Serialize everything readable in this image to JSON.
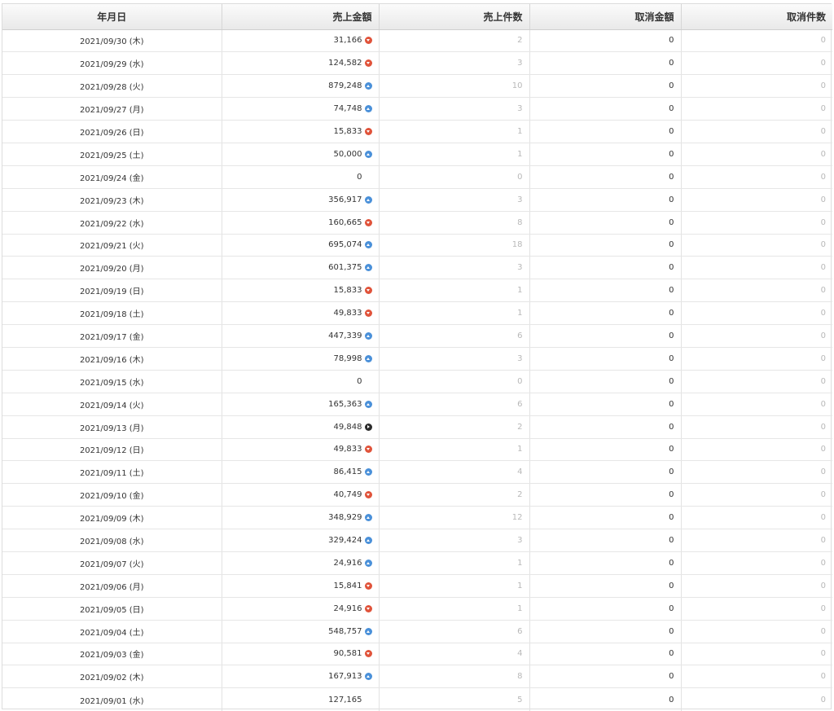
{
  "table": {
    "headers": {
      "date": "年月日",
      "sales_amount": "売上金額",
      "sales_count": "売上件数",
      "cancel_amount": "取消金額",
      "cancel_count": "取消件数"
    },
    "trend_icons": {
      "up": "arrow-up-circle-icon",
      "down": "arrow-down-circle-icon",
      "flat": "arrow-right-circle-icon"
    },
    "colors": {
      "up": "#4a90d9",
      "down": "#e0533a",
      "flat": "#2b2b2b"
    },
    "rows": [
      {
        "date": "2021/09/30 (木)",
        "sales_amount": "31,166",
        "trend": "down",
        "sales_count": "2",
        "cancel_amount": "0",
        "cancel_count": "0"
      },
      {
        "date": "2021/09/29 (水)",
        "sales_amount": "124,582",
        "trend": "down",
        "sales_count": "3",
        "cancel_amount": "0",
        "cancel_count": "0"
      },
      {
        "date": "2021/09/28 (火)",
        "sales_amount": "879,248",
        "trend": "up",
        "sales_count": "10",
        "cancel_amount": "0",
        "cancel_count": "0"
      },
      {
        "date": "2021/09/27 (月)",
        "sales_amount": "74,748",
        "trend": "up",
        "sales_count": "3",
        "cancel_amount": "0",
        "cancel_count": "0"
      },
      {
        "date": "2021/09/26 (日)",
        "sales_amount": "15,833",
        "trend": "down",
        "sales_count": "1",
        "cancel_amount": "0",
        "cancel_count": "0"
      },
      {
        "date": "2021/09/25 (土)",
        "sales_amount": "50,000",
        "trend": "up",
        "sales_count": "1",
        "cancel_amount": "0",
        "cancel_count": "0"
      },
      {
        "date": "2021/09/24 (金)",
        "sales_amount": "0",
        "trend": "none",
        "sales_count": "0",
        "cancel_amount": "0",
        "cancel_count": "0"
      },
      {
        "date": "2021/09/23 (木)",
        "sales_amount": "356,917",
        "trend": "up",
        "sales_count": "3",
        "cancel_amount": "0",
        "cancel_count": "0"
      },
      {
        "date": "2021/09/22 (水)",
        "sales_amount": "160,665",
        "trend": "down",
        "sales_count": "8",
        "cancel_amount": "0",
        "cancel_count": "0"
      },
      {
        "date": "2021/09/21 (火)",
        "sales_amount": "695,074",
        "trend": "up",
        "sales_count": "18",
        "cancel_amount": "0",
        "cancel_count": "0"
      },
      {
        "date": "2021/09/20 (月)",
        "sales_amount": "601,375",
        "trend": "up",
        "sales_count": "3",
        "cancel_amount": "0",
        "cancel_count": "0"
      },
      {
        "date": "2021/09/19 (日)",
        "sales_amount": "15,833",
        "trend": "down",
        "sales_count": "1",
        "cancel_amount": "0",
        "cancel_count": "0"
      },
      {
        "date": "2021/09/18 (土)",
        "sales_amount": "49,833",
        "trend": "down",
        "sales_count": "1",
        "cancel_amount": "0",
        "cancel_count": "0"
      },
      {
        "date": "2021/09/17 (金)",
        "sales_amount": "447,339",
        "trend": "up",
        "sales_count": "6",
        "cancel_amount": "0",
        "cancel_count": "0"
      },
      {
        "date": "2021/09/16 (木)",
        "sales_amount": "78,998",
        "trend": "up",
        "sales_count": "3",
        "cancel_amount": "0",
        "cancel_count": "0"
      },
      {
        "date": "2021/09/15 (水)",
        "sales_amount": "0",
        "trend": "none",
        "sales_count": "0",
        "cancel_amount": "0",
        "cancel_count": "0"
      },
      {
        "date": "2021/09/14 (火)",
        "sales_amount": "165,363",
        "trend": "up",
        "sales_count": "6",
        "cancel_amount": "0",
        "cancel_count": "0"
      },
      {
        "date": "2021/09/13 (月)",
        "sales_amount": "49,848",
        "trend": "flat",
        "sales_count": "2",
        "cancel_amount": "0",
        "cancel_count": "0"
      },
      {
        "date": "2021/09/12 (日)",
        "sales_amount": "49,833",
        "trend": "down",
        "sales_count": "1",
        "cancel_amount": "0",
        "cancel_count": "0"
      },
      {
        "date": "2021/09/11 (土)",
        "sales_amount": "86,415",
        "trend": "up",
        "sales_count": "4",
        "cancel_amount": "0",
        "cancel_count": "0"
      },
      {
        "date": "2021/09/10 (金)",
        "sales_amount": "40,749",
        "trend": "down",
        "sales_count": "2",
        "cancel_amount": "0",
        "cancel_count": "0"
      },
      {
        "date": "2021/09/09 (木)",
        "sales_amount": "348,929",
        "trend": "up",
        "sales_count": "12",
        "cancel_amount": "0",
        "cancel_count": "0"
      },
      {
        "date": "2021/09/08 (水)",
        "sales_amount": "329,424",
        "trend": "up",
        "sales_count": "3",
        "cancel_amount": "0",
        "cancel_count": "0"
      },
      {
        "date": "2021/09/07 (火)",
        "sales_amount": "24,916",
        "trend": "up",
        "sales_count": "1",
        "cancel_amount": "0",
        "cancel_count": "0"
      },
      {
        "date": "2021/09/06 (月)",
        "sales_amount": "15,841",
        "trend": "down",
        "sales_count": "1",
        "cancel_amount": "0",
        "cancel_count": "0"
      },
      {
        "date": "2021/09/05 (日)",
        "sales_amount": "24,916",
        "trend": "down",
        "sales_count": "1",
        "cancel_amount": "0",
        "cancel_count": "0"
      },
      {
        "date": "2021/09/04 (土)",
        "sales_amount": "548,757",
        "trend": "up",
        "sales_count": "6",
        "cancel_amount": "0",
        "cancel_count": "0"
      },
      {
        "date": "2021/09/03 (金)",
        "sales_amount": "90,581",
        "trend": "down",
        "sales_count": "4",
        "cancel_amount": "0",
        "cancel_count": "0"
      },
      {
        "date": "2021/09/02 (木)",
        "sales_amount": "167,913",
        "trend": "up",
        "sales_count": "8",
        "cancel_amount": "0",
        "cancel_count": "0"
      },
      {
        "date": "2021/09/01 (水)",
        "sales_amount": "127,165",
        "trend": "none",
        "sales_count": "5",
        "cancel_amount": "0",
        "cancel_count": "0"
      }
    ]
  }
}
